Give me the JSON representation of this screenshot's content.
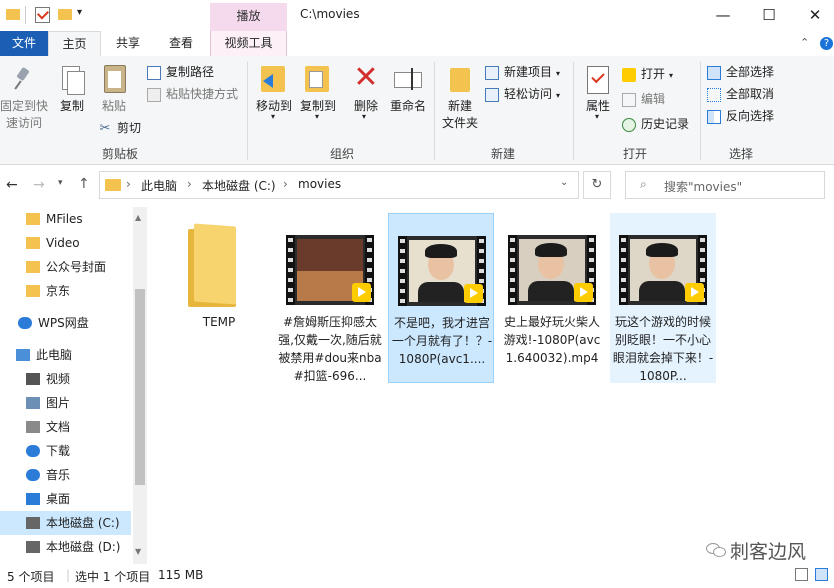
{
  "title_bar": {
    "contextual_tab": "播放",
    "path_title": "C:\\movies",
    "minimize": "—",
    "maximize": "☐",
    "close": "✕"
  },
  "ribbon_tabs": [
    "文件",
    "主页",
    "共享",
    "查看",
    "视频工具"
  ],
  "ribbon": {
    "clipboard": {
      "pin_label_1": "固定到快",
      "pin_label_2": "速访问",
      "copy": "复制",
      "paste": "粘贴",
      "copy_path": "复制路径",
      "paste_shortcut": "粘贴快捷方式",
      "cut": "剪切",
      "group": "剪贴板"
    },
    "organize": {
      "move_to": "移动到",
      "copy_to": "复制到",
      "delete": "删除",
      "rename": "重命名",
      "group": "组织"
    },
    "new": {
      "new_folder_1": "新建",
      "new_folder_2": "文件夹",
      "new_item": "新建项目",
      "easy_access": "轻松访问",
      "group": "新建"
    },
    "open": {
      "properties": "属性",
      "open": "打开",
      "edit": "编辑",
      "history": "历史记录",
      "group": "打开"
    },
    "select": {
      "select_all": "全部选择",
      "select_none": "全部取消",
      "invert": "反向选择",
      "group": "选择"
    }
  },
  "address": {
    "crumbs": [
      "此电脑",
      "本地磁盘 (C:)",
      "movies"
    ],
    "search_placeholder": "搜索\"movies\""
  },
  "nav": [
    {
      "label": "MFiles",
      "icon": "folder-icon"
    },
    {
      "label": "Video",
      "icon": "folder-icon"
    },
    {
      "label": "公众号封面",
      "icon": "folder-icon"
    },
    {
      "label": "京东",
      "icon": "folder-icon"
    },
    {
      "label": "WPS网盘",
      "icon": "cloud-icon"
    },
    {
      "label": "此电脑",
      "icon": "computer-icon"
    },
    {
      "label": "视频",
      "icon": "video-icon"
    },
    {
      "label": "图片",
      "icon": "picture-icon"
    },
    {
      "label": "文档",
      "icon": "document-icon"
    },
    {
      "label": "下载",
      "icon": "download-icon"
    },
    {
      "label": "音乐",
      "icon": "music-icon"
    },
    {
      "label": "桌面",
      "icon": "desktop-icon"
    },
    {
      "label": "本地磁盘 (C:)",
      "icon": "drive-icon"
    },
    {
      "label": "本地磁盘 (D:)",
      "icon": "drive-icon"
    }
  ],
  "files": [
    {
      "name": "TEMP",
      "type": "folder"
    },
    {
      "name": "#詹姆斯压抑感太强,仅戴一次,随后就被禁用#dou来nba#扣篮-696...",
      "type": "video"
    },
    {
      "name": "不是吧，我才进宫一个月就有了！？-1080P(avc1....",
      "type": "video"
    },
    {
      "name": "史上最好玩火柴人游戏!-1080P(avc1.640032).mp4",
      "type": "video"
    },
    {
      "name": "玩这个游戏的时候别眨眼！一不小心眼泪就会掉下来！-1080P...",
      "type": "video"
    }
  ],
  "status": {
    "count": "5 个项目",
    "selected": "选中 1 个项目",
    "size": "115 MB"
  },
  "watermark": "刺客边风",
  "colors": {
    "accent": "#1a5fb4",
    "selection": "#cce8ff",
    "contextual": "#f5d9ec"
  }
}
